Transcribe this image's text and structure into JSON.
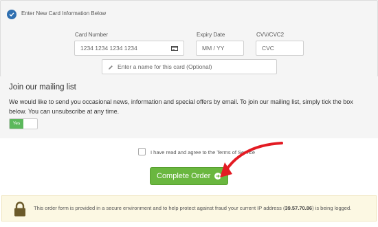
{
  "card": {
    "new_card_label": "Enter New Card Information Below",
    "card_number_label": "Card Number",
    "card_number_placeholder": "1234 1234 1234 1234",
    "expiry_label": "Expiry Date",
    "expiry_placeholder": "MM / YY",
    "cvv_label": "CVV/CVC2",
    "cvv_placeholder": "CVC",
    "name_placeholder": "Enter a name for this card (Optional)"
  },
  "mailing": {
    "title": "Join our mailing list",
    "text": "We would like to send you occasional news, information and special offers by email. To join our mailing list, simply tick the box below. You can unsubscribe at any time.",
    "toggle_label": "Yes"
  },
  "terms": {
    "prefix": "I have read and agree to the ",
    "link": "Terms of Service"
  },
  "order": {
    "button_label": "Complete Order"
  },
  "secure": {
    "prefix": "This order form is provided in a secure environment and to help protect against fraud your current IP address (",
    "ip": "39.57.70.86",
    "suffix": ") is being logged."
  },
  "colors": {
    "accent_green": "#6ab73f",
    "check_blue": "#2f6fb0",
    "annotation_red": "#e31b23"
  }
}
